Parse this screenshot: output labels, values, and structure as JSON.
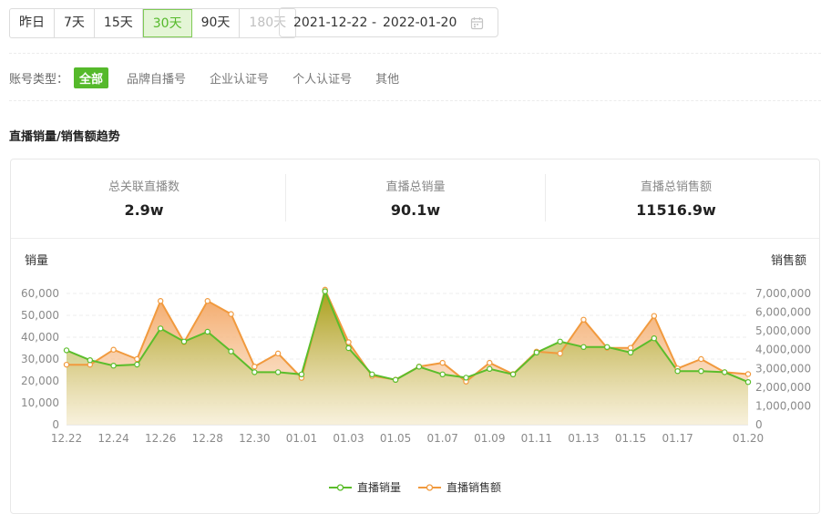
{
  "range_tabs": [
    {
      "label": "昨日",
      "state": "normal"
    },
    {
      "label": "7天",
      "state": "normal"
    },
    {
      "label": "15天",
      "state": "normal"
    },
    {
      "label": "30天",
      "state": "active"
    },
    {
      "label": "90天",
      "state": "normal"
    },
    {
      "label": "180天",
      "state": "disabled"
    }
  ],
  "date_range": {
    "start": "2021-12-22",
    "separator": "-",
    "end": "2022-01-20"
  },
  "account_type": {
    "label": "账号类型：",
    "options": [
      "全部",
      "品牌自播号",
      "企业认证号",
      "个人认证号",
      "其他"
    ],
    "active_index": 0
  },
  "section_title": "直播销量/销售额趋势",
  "stats": [
    {
      "title": "总关联直播数",
      "value": "2.9w"
    },
    {
      "title": "直播总销量",
      "value": "90.1w"
    },
    {
      "title": "直播总销售额",
      "value": "11516.9w"
    }
  ],
  "colors": {
    "green": "#5bbd2b",
    "orange": "#f19a3e",
    "active_tab_bg": "#e4f5d6"
  },
  "chart_data": {
    "type": "area",
    "y_left_label": "销量",
    "y_right_label": "销售额",
    "y_left_range": [
      0,
      60000
    ],
    "y_left_ticks": [
      "0",
      "10,000",
      "20,000",
      "30,000",
      "40,000",
      "50,000",
      "60,000"
    ],
    "y_right_range": [
      0,
      7000000
    ],
    "y_right_ticks": [
      "0",
      "1,000,000",
      "2,000,000",
      "3,000,000",
      "4,000,000",
      "5,000,000",
      "6,000,000",
      "7,000,000"
    ],
    "x": [
      "12.22",
      "12.23",
      "12.24",
      "12.25",
      "12.26",
      "12.27",
      "12.28",
      "12.29",
      "12.30",
      "12.31",
      "01.01",
      "01.02",
      "01.03",
      "01.04",
      "01.05",
      "01.06",
      "01.07",
      "01.08",
      "01.09",
      "01.10",
      "01.11",
      "01.12",
      "01.13",
      "01.14",
      "01.15",
      "01.16",
      "01.17",
      "01.18",
      "01.19",
      "01.20"
    ],
    "x_tick_labels": [
      "12.22",
      "",
      "12.24",
      "",
      "12.26",
      "",
      "12.28",
      "",
      "12.30",
      "",
      "01.01",
      "",
      "01.03",
      "",
      "01.05",
      "",
      "01.07",
      "",
      "01.09",
      "",
      "01.11",
      "",
      "01.13",
      "",
      "01.15",
      "",
      "01.17",
      "",
      "",
      "01.20"
    ],
    "grid": true,
    "legend_position": "bottom-center",
    "series": [
      {
        "name": "直播销量",
        "axis": "left",
        "color": "#5bbd2b",
        "values": [
          34000,
          29500,
          27000,
          27500,
          44000,
          38000,
          42500,
          33500,
          24000,
          24000,
          23000,
          61000,
          35000,
          23000,
          20500,
          26500,
          23000,
          21500,
          25500,
          23000,
          33000,
          38000,
          35500,
          35500,
          33000,
          39500,
          24500,
          24500,
          24000,
          19500
        ]
      },
      {
        "name": "直播销售额",
        "axis": "right",
        "color": "#f19a3e",
        "values": [
          3200000,
          3200000,
          4000000,
          3500000,
          6600000,
          4400000,
          6600000,
          5900000,
          3100000,
          3800000,
          2500000,
          7200000,
          4400000,
          2600000,
          2400000,
          3100000,
          3300000,
          2300000,
          3300000,
          2700000,
          3900000,
          3800000,
          5600000,
          4100000,
          4100000,
          5800000,
          3000000,
          3500000,
          2800000,
          2700000
        ]
      }
    ]
  }
}
